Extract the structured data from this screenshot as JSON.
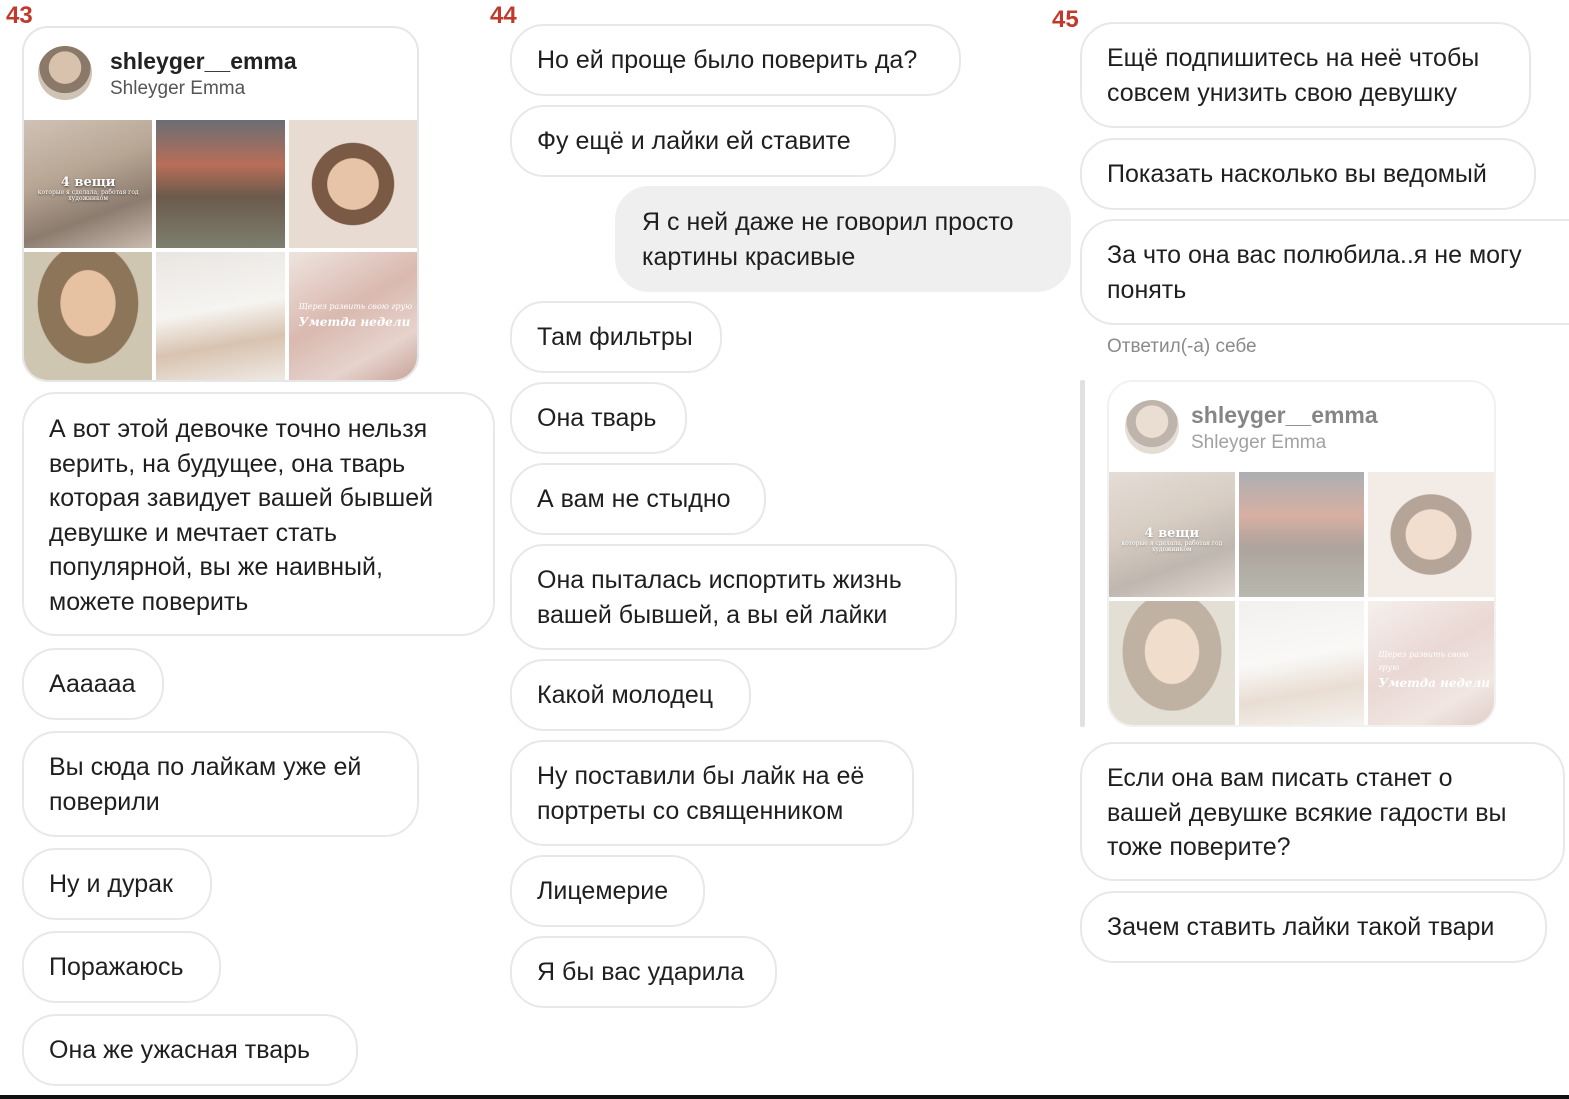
{
  "panels": [
    {
      "number": "43",
      "card": {
        "username": "shleyger__emma",
        "full_name": "Shleyger Emma",
        "tile1_title": "4 вещи",
        "tile1_subtitle": "которые я сделала, работая год художником",
        "tile6_line1": "Щерез развить свою грую",
        "tile6_line2": "Уметда недели"
      },
      "messages": [
        "А вот этой девочке точно нельзя\nверить, на будущее, она тварь\nкоторая завидует вашей бывшей\nдевушке и мечтает стать\nпопулярной, вы же наивный,\nможете поверить",
        "Аааааа",
        "Вы сюда по лайкам уже ей\nповерили",
        "Ну и дурак",
        "Поражаюсь",
        "Она же ужасная тварь"
      ]
    },
    {
      "number": "44",
      "messages": [
        "Но ей проще было поверить да?",
        "Фу ещё и лайки ей ставите",
        "Я с ней даже не говорил просто\nкартины красивые",
        "Там фильтры",
        "Она тварь",
        "А вам не стыдно",
        "Она пыталась испортить жизнь\nвашей бывшей, а вы ей лайки",
        "Какой молодец",
        "Ну поставили бы лайк на её\nпортреты со священником",
        "Лицемерие",
        "Я бы вас ударила"
      ]
    },
    {
      "number": "45",
      "messages": [
        "Ещё подпишитесь на неё чтобы\nсовсем унизить свою девушку",
        "Показать насколько вы ведомый",
        "За что она вас полюбила..я не могу\nпонять",
        "Если она вам писать станет о\nвашей девушке всякие гадости вы\nтоже поверите?",
        "Зачем ставить лайки такой твари"
      ],
      "reply_label": "Ответил(-а) себе",
      "card": {
        "username": "shleyger__emma",
        "full_name": "Shleyger Emma",
        "tile1_title": "4 вещи",
        "tile1_subtitle": "которые я сделала, работая год художником",
        "tile6_line1": "Щерез развить свою грую",
        "tile6_line2": "Уметда недели"
      }
    }
  ]
}
